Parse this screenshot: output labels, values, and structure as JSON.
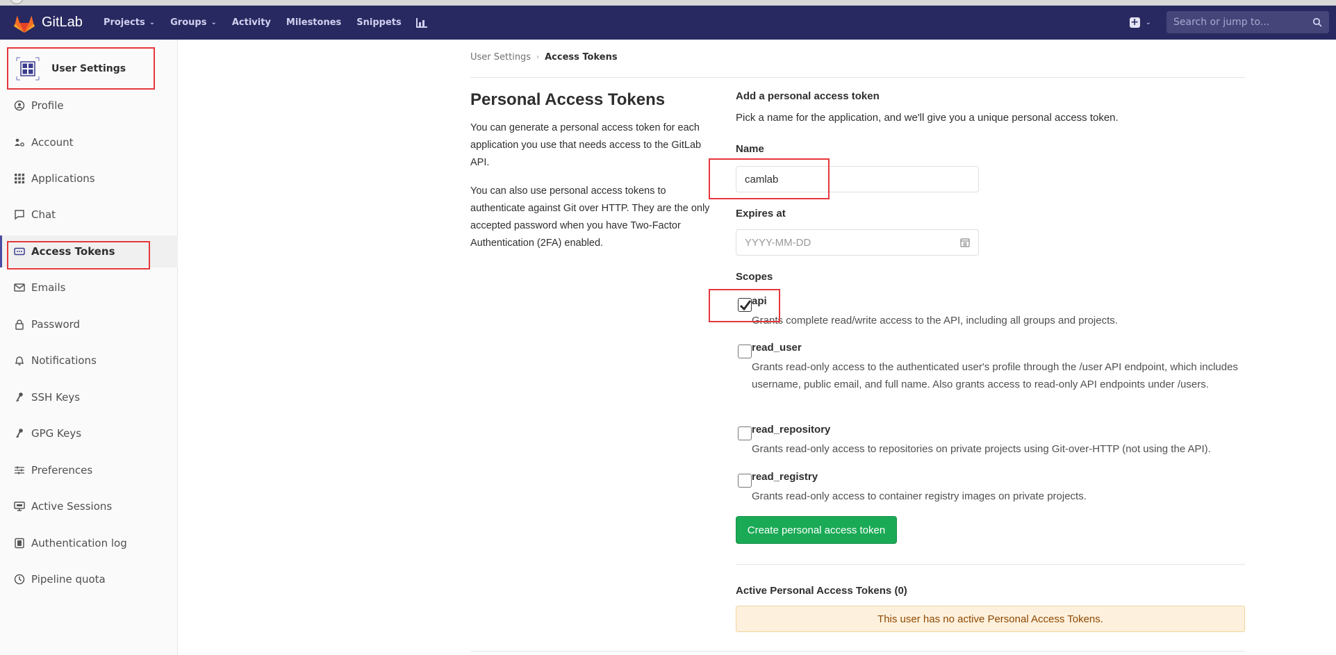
{
  "navbar": {
    "brand": "GitLab",
    "links": [
      {
        "label": "Projects",
        "dropdown": true
      },
      {
        "label": "Groups",
        "dropdown": true
      },
      {
        "label": "Activity",
        "dropdown": false
      },
      {
        "label": "Milestones",
        "dropdown": false
      },
      {
        "label": "Snippets",
        "dropdown": false
      }
    ],
    "chart_icon": "chart-icon",
    "plus_icon": "plus-square-icon",
    "search": {
      "placeholder": "Search or jump to..."
    }
  },
  "sidebar": {
    "title": "User Settings",
    "items": [
      {
        "label": "Profile",
        "icon": "profile-icon"
      },
      {
        "label": "Account",
        "icon": "account-icon"
      },
      {
        "label": "Applications",
        "icon": "applications-icon"
      },
      {
        "label": "Chat",
        "icon": "chat-icon"
      },
      {
        "label": "Access Tokens",
        "icon": "access-tokens-icon",
        "active": true
      },
      {
        "label": "Emails",
        "icon": "email-icon"
      },
      {
        "label": "Password",
        "icon": "lock-icon"
      },
      {
        "label": "Notifications",
        "icon": "bell-icon"
      },
      {
        "label": "SSH Keys",
        "icon": "key-icon"
      },
      {
        "label": "GPG Keys",
        "icon": "key-icon"
      },
      {
        "label": "Preferences",
        "icon": "sliders-icon"
      },
      {
        "label": "Active Sessions",
        "icon": "monitor-icon"
      },
      {
        "label": "Authentication log",
        "icon": "log-icon"
      },
      {
        "label": "Pipeline quota",
        "icon": "quota-icon"
      }
    ]
  },
  "breadcrumb": {
    "parent": "User Settings",
    "current": "Access Tokens"
  },
  "intro": {
    "title": "Personal Access Tokens",
    "p1": "You can generate a personal access token for each application you use that needs access to the GitLab API.",
    "p2": "You can also use personal access tokens to authenticate against Git over HTTP. They are the only accepted password when you have Two-Factor Authentication (2FA) enabled."
  },
  "form": {
    "heading": "Add a personal access token",
    "subtitle": "Pick a name for the application, and we'll give you a unique personal access token.",
    "name_label": "Name",
    "name_value": "camlab",
    "expires_label": "Expires at",
    "expires_placeholder": "YYYY-MM-DD",
    "scopes_label": "Scopes",
    "scopes": [
      {
        "name": "api",
        "checked": true,
        "desc": "Grants complete read/write access to the API, including all groups and projects."
      },
      {
        "name": "read_user",
        "checked": false,
        "desc": "Grants read-only access to the authenticated user's profile through the /user API endpoint, which includes username, public email, and full name. Also grants access to read-only API endpoints under /users."
      },
      {
        "name": "read_repository",
        "checked": false,
        "desc": "Grants read-only access to repositories on private projects using Git-over-HTTP (not using the API)."
      },
      {
        "name": "read_registry",
        "checked": false,
        "desc": "Grants read-only access to container registry images on private projects."
      }
    ],
    "submit_label": "Create personal access token"
  },
  "active_tokens": {
    "title": "Active Personal Access Tokens (0)",
    "empty_message": "This user has no active Personal Access Tokens."
  },
  "colors": {
    "navbar": "#292961",
    "primary_button": "#1aaa55",
    "highlight": "#e5373b",
    "alert_bg": "#fdf1dd"
  }
}
